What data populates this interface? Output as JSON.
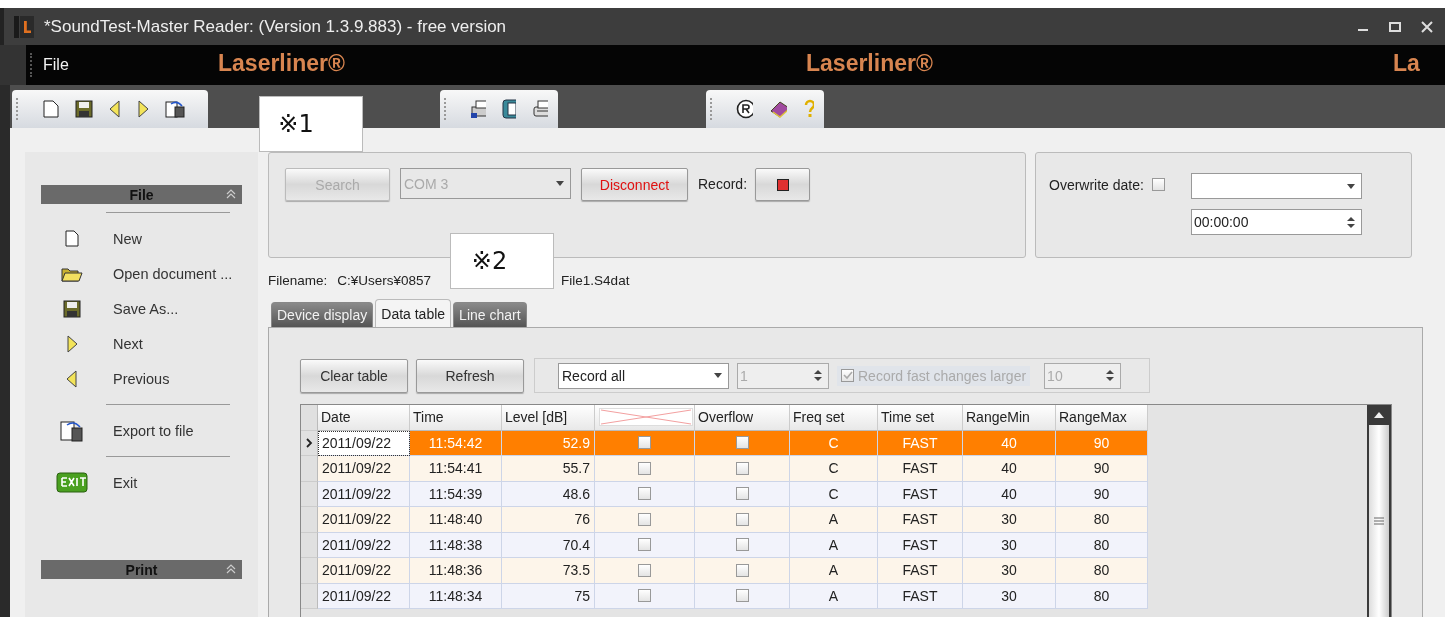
{
  "window": {
    "title": "*SoundTest-Master Reader: (Version 1.3.9.883) - free version"
  },
  "menu": {
    "items": [
      "File"
    ],
    "logos": [
      "Laserliner®",
      "Laserliner®",
      "La"
    ]
  },
  "annotations": [
    "※1",
    "※2"
  ],
  "sidebar": {
    "sections": [
      {
        "title": "File",
        "expanded": true,
        "items": [
          {
            "label": "New",
            "kind": "new"
          },
          {
            "label": "Open document ...",
            "kind": "open"
          },
          {
            "label": "Save As...",
            "kind": "save"
          },
          {
            "label": "Next",
            "kind": "next"
          },
          {
            "label": "Previous",
            "kind": "previous",
            "separator_after": true
          },
          {
            "label": "Export to file",
            "kind": "export",
            "separator_after": true
          },
          {
            "label": "Exit",
            "kind": "exit"
          }
        ]
      },
      {
        "title": "Print",
        "expanded": true
      }
    ]
  },
  "connection": {
    "search_button": {
      "label": "Search",
      "disabled": true
    },
    "port": {
      "value": "COM 3",
      "disabled": true
    },
    "disconnect_button": {
      "label": "Disconnect"
    },
    "record_label": "Record:"
  },
  "overwrite": {
    "label": "Overwrite date:",
    "checked": false,
    "time": "00:00:00"
  },
  "filename": {
    "label": "Filename:",
    "path_start": "C:¥Users¥0857",
    "path_end": "File1.S4dat"
  },
  "tabs": [
    {
      "label": "Device display",
      "selected": false
    },
    {
      "label": "Data table",
      "selected": true
    },
    {
      "label": "Line chart",
      "selected": false
    }
  ],
  "table_toolbar": {
    "clear_button": "Clear table",
    "refresh_button": "Refresh",
    "mode": "Record all",
    "count": "1",
    "fast_changes": {
      "label": "Record fast changes larger",
      "checked": true,
      "disabled": true
    },
    "threshold": "10"
  },
  "table": {
    "columns": [
      "Date",
      "Time",
      "Level [dB]",
      "",
      "Overflow",
      "Freq set",
      "Time set",
      "RangeMin",
      "RangeMax"
    ],
    "rows": [
      {
        "date": "2011/09/22",
        "time": "11:54:42",
        "level": "52.9",
        "column_4": false,
        "overflow": false,
        "freq": "C",
        "timeset": "FAST",
        "min": "40",
        "max": "90",
        "selected": true
      },
      {
        "date": "2011/09/22",
        "time": "11:54:41",
        "level": "55.7",
        "column_4": false,
        "overflow": false,
        "freq": "C",
        "timeset": "FAST",
        "min": "40",
        "max": "90",
        "selected": false
      },
      {
        "date": "2011/09/22",
        "time": "11:54:39",
        "level": "48.6",
        "column_4": false,
        "overflow": false,
        "freq": "C",
        "timeset": "FAST",
        "min": "40",
        "max": "90",
        "selected": false
      },
      {
        "date": "2011/09/22",
        "time": "11:48:40",
        "level": "76",
        "column_4": false,
        "overflow": false,
        "freq": "A",
        "timeset": "FAST",
        "min": "30",
        "max": "80",
        "selected": false
      },
      {
        "date": "2011/09/22",
        "time": "11:48:38",
        "level": "70.4",
        "column_4": false,
        "overflow": false,
        "freq": "A",
        "timeset": "FAST",
        "min": "30",
        "max": "80",
        "selected": false
      },
      {
        "date": "2011/09/22",
        "time": "11:48:36",
        "level": "73.5",
        "column_4": false,
        "overflow": false,
        "freq": "A",
        "timeset": "FAST",
        "min": "30",
        "max": "80",
        "selected": false
      },
      {
        "date": "2011/09/22",
        "time": "11:48:34",
        "level": "75",
        "column_4": false,
        "overflow": false,
        "freq": "A",
        "timeset": "FAST",
        "min": "30",
        "max": "80",
        "selected": false
      }
    ]
  }
}
